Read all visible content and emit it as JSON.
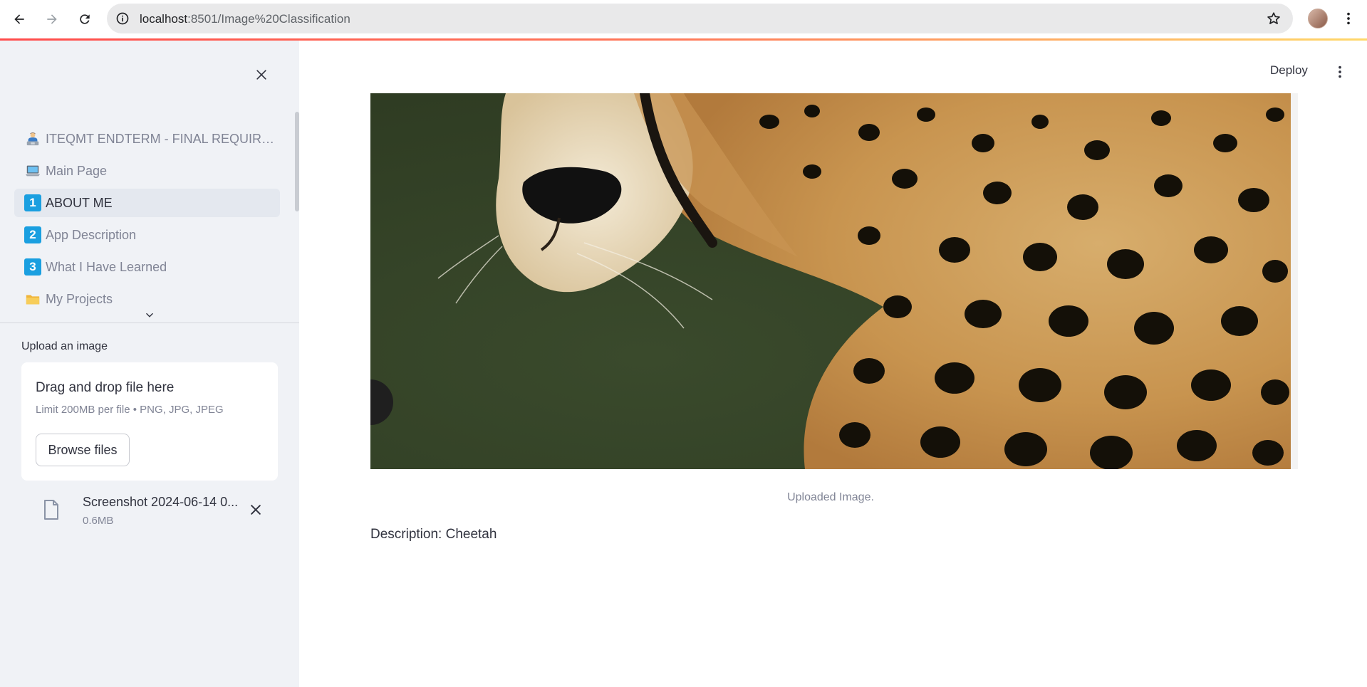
{
  "browser": {
    "url_host": "localhost",
    "url_path": ":8501/Image%20Classification"
  },
  "sidebar": {
    "nav_items": [
      {
        "icon": "👩‍💻",
        "label": "ITEQMT ENDTERM - FINAL REQUIREMENT",
        "active": false
      },
      {
        "icon": "💻",
        "label": "Main Page",
        "active": false
      },
      {
        "icon": "1",
        "label": "ABOUT ME",
        "active": true
      },
      {
        "icon": "2",
        "label": "App Description",
        "active": false
      },
      {
        "icon": "3",
        "label": "What I Have Learned",
        "active": false
      },
      {
        "icon": "📁",
        "label": "My Projects",
        "active": false
      }
    ],
    "uploader": {
      "label": "Upload an image",
      "drop_title": "Drag and drop file here",
      "limit_text": "Limit 200MB per file • PNG, JPG, JPEG",
      "browse_label": "Browse files",
      "file": {
        "name": "Screenshot 2024-06-14 0...",
        "size": "0.6MB"
      }
    }
  },
  "main": {
    "deploy_label": "Deploy",
    "image_caption": "Uploaded Image.",
    "description": "Description: Cheetah"
  },
  "colors": {
    "accent": "#ff4b4b",
    "sidebar_bg": "#f0f2f6",
    "number_badge": "#1a9fe0"
  }
}
